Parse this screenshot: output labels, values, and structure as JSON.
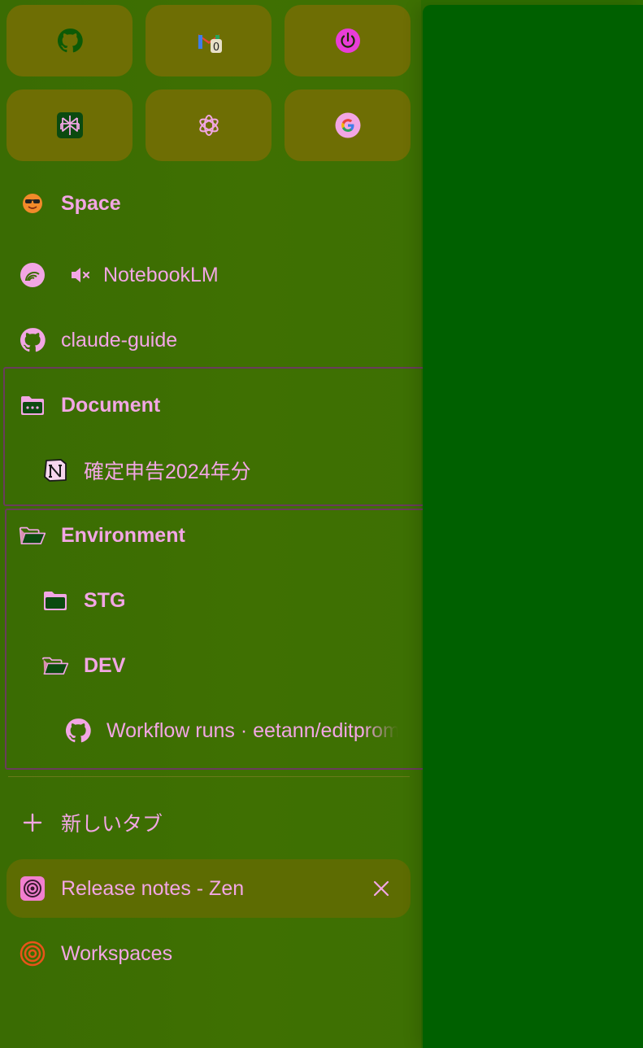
{
  "pinned_tiles": [
    {
      "icon": "github-icon"
    },
    {
      "icon": "gmail-icon",
      "badge": "0"
    },
    {
      "icon": "power-icon"
    },
    {
      "icon": "perplexity-icon"
    },
    {
      "icon": "chatgpt-icon"
    },
    {
      "icon": "google-icon"
    }
  ],
  "tabs": {
    "space": "Space",
    "notebooklm": "NotebookLM",
    "claude_guide": "claude-guide"
  },
  "folders": {
    "document": {
      "label": "Document",
      "items": [
        "確定申告2024年分"
      ]
    },
    "environment": {
      "label": "Environment",
      "subfolders": {
        "stg": "STG",
        "dev": "DEV"
      },
      "dev_items": [
        "Workflow runs · eetann/editprompt"
      ]
    }
  },
  "new_tab_label": "新しいタブ",
  "active_tab": {
    "label": "Release notes - Zen"
  },
  "workspaces_label": "Workspaces",
  "colors": {
    "text": "#f2a6e4",
    "sidebar_bg": "#3d6f02",
    "tile_bg": "#6e6e04",
    "content_bg": "#006000",
    "group_border": "#6a3c5c",
    "accent": "#e83dd8"
  }
}
